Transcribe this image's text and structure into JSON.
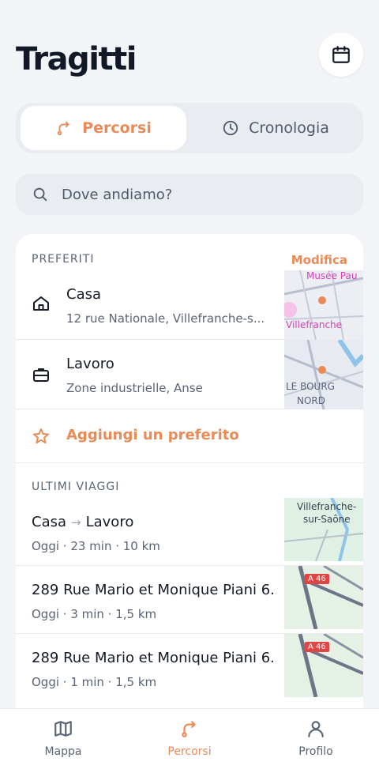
{
  "header": {
    "title": "Tragitti"
  },
  "tabs": [
    {
      "label": "Percorsi",
      "active": true
    },
    {
      "label": "Cronologia",
      "active": false
    }
  ],
  "search": {
    "placeholder": "Dove andiamo?"
  },
  "favorites": {
    "section_label": "PREFERITI",
    "edit_label": "Modifica",
    "items": [
      {
        "name": "Casa",
        "address": "12 rue Nationale, Villefranche-s...",
        "icon": "home-icon",
        "map_labels": [
          "Musée Pau",
          "Villefranche"
        ]
      },
      {
        "name": "Lavoro",
        "address": "Zone industrielle, Anse",
        "icon": "briefcase-icon",
        "map_labels": [
          "LE BOURG",
          "NORD"
        ]
      }
    ],
    "add_label": "Aggiungi un preferito"
  },
  "recent": {
    "section_label": "ULTIMI VIAGGI",
    "trips": [
      {
        "from": "Casa",
        "to": "Lavoro",
        "meta": "Oggi · 23 min · 10 km",
        "map_labels": [
          "Villefranche-",
          "sur-Saône"
        ]
      },
      {
        "title": "289 Rue Mario et Monique Piani 6...",
        "meta": "Oggi · 3 min · 1,5 km",
        "map_labels": [
          "A 46"
        ]
      },
      {
        "title": "289 Rue Mario et Monique Piani 6...",
        "meta": "Oggi · 1 min · 1,5 km",
        "map_labels": [
          "A 46"
        ]
      }
    ]
  },
  "nav": [
    {
      "label": "Mappa",
      "icon": "map-icon",
      "active": false
    },
    {
      "label": "Percorsi",
      "icon": "route-icon",
      "active": true
    },
    {
      "label": "Profilo",
      "icon": "profile-icon",
      "active": false
    }
  ],
  "colors": {
    "accent": "#ea8a56",
    "background": "#f2f4f7",
    "text": "#141a26",
    "muted": "#5a6474"
  }
}
